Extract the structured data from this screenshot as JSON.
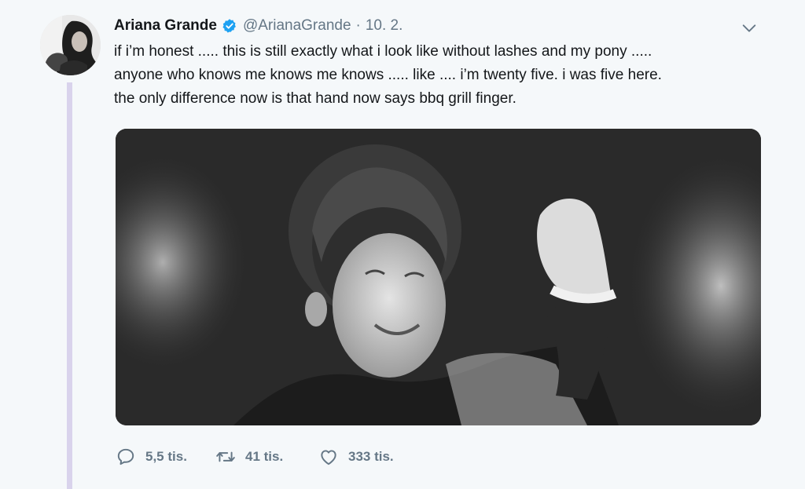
{
  "tweet": {
    "author_name": "Ariana Grande",
    "handle": "@ArianaGrande",
    "separator": "·",
    "date": "10. 2.",
    "text_lines": [
      "if i’m honest ..... this is still exactly what i look like without lashes and my pony .....",
      "anyone who knows me knows me knows ..... like .... i’m twenty five. i was five here.",
      "the only difference now is that hand now says bbq grill finger."
    ]
  },
  "actions": {
    "replies": "5,5 tis.",
    "retweets": "41 tis.",
    "likes": "333 tis."
  },
  "icons": {
    "verified": "verified-badge-icon",
    "caret": "chevron-down-icon",
    "reply": "reply-icon",
    "retweet": "retweet-icon",
    "like": "heart-icon"
  },
  "colors": {
    "verified_blue": "#1da1f2",
    "text": "#14171a",
    "muted": "#657786",
    "thread_line": "#d9d3ec",
    "background": "#f5f8fa"
  }
}
